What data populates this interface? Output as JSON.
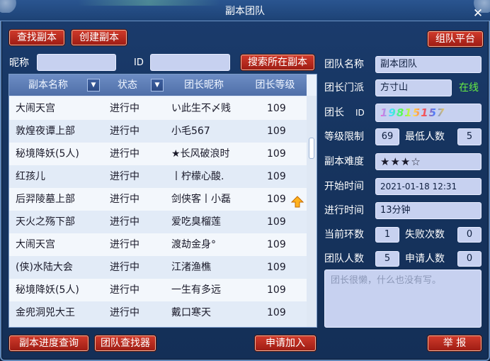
{
  "window": {
    "title": "副本团队",
    "close_glyph": "✕"
  },
  "toolbar": {
    "find_label": "查找副本",
    "create_label": "创建副本",
    "platform_label": "组队平台"
  },
  "search": {
    "nickname_label": "昵称",
    "nickname_value": "",
    "id_label": "ID",
    "id_value": "",
    "search_button_label": "搜索所在副本"
  },
  "table": {
    "headers": [
      "副本名称",
      "状态",
      "团长昵称",
      "团长等级"
    ],
    "rows": [
      {
        "name": "大闹天宫",
        "status": "进行中",
        "leader": "い此生不〆贱",
        "level": "109"
      },
      {
        "name": "敦煌夜谭上部",
        "status": "进行中",
        "leader": "小毛567",
        "level": "109"
      },
      {
        "name": "秘境降妖(5人)",
        "status": "进行中",
        "leader": "★长风破浪时",
        "level": "109"
      },
      {
        "name": "红孩儿",
        "status": "进行中",
        "leader": "丨柠檬心酸.",
        "level": "109"
      },
      {
        "name": "后羿陵墓上部",
        "status": "进行中",
        "leader": "剑侠客丨小磊",
        "level": "109"
      },
      {
        "name": "天火之殇下部",
        "status": "进行中",
        "leader": "爱吃臭榴莲",
        "level": "109"
      },
      {
        "name": "大闹天宫",
        "status": "进行中",
        "leader": "渡劫金身°",
        "level": "109"
      },
      {
        "name": "(侠)水陆大会",
        "status": "进行中",
        "leader": "江渚渔樵",
        "level": "109"
      },
      {
        "name": "秘境降妖(5人)",
        "status": "进行中",
        "leader": "一生有多远",
        "level": "109"
      },
      {
        "name": "金兜洞兕大王",
        "status": "进行中",
        "leader": "戴口寒天",
        "level": "109"
      }
    ]
  },
  "details": {
    "team_name_label": "团队名称",
    "team_name_value": "副本团队",
    "sect_label": "团长门派",
    "sect_value": "方寸山",
    "online_status": "在线",
    "leader_label": "团长",
    "leader_id_label": "ID",
    "leader_id_value": "19815157",
    "level_limit_label": "等级限制",
    "level_limit_value": "69",
    "min_people_label": "最低人数",
    "min_people_value": "5",
    "difficulty_label": "副本难度",
    "difficulty_value": "★★★☆",
    "start_time_label": "开始时间",
    "start_time_value": "2021-01-18 12:31",
    "elapsed_label": "进行时间",
    "elapsed_value": "13分钟",
    "round_label": "当前环数",
    "round_value": "1",
    "fail_label": "失败次数",
    "fail_value": "0",
    "members_label": "团队人数",
    "members_value": "5",
    "applicants_label": "申请人数",
    "applicants_value": "0",
    "description": "团长很懒，什么也没有写。"
  },
  "footer": {
    "progress_label": "副本进度查询",
    "finder_label": "团队查找器",
    "apply_label": "申请加入",
    "report_label": "举 报"
  },
  "colors": {
    "panel_bg": "#16345f",
    "button_red": "#c0302a",
    "field_bg": "#c7d1f0",
    "online_green": "#66ee44"
  }
}
